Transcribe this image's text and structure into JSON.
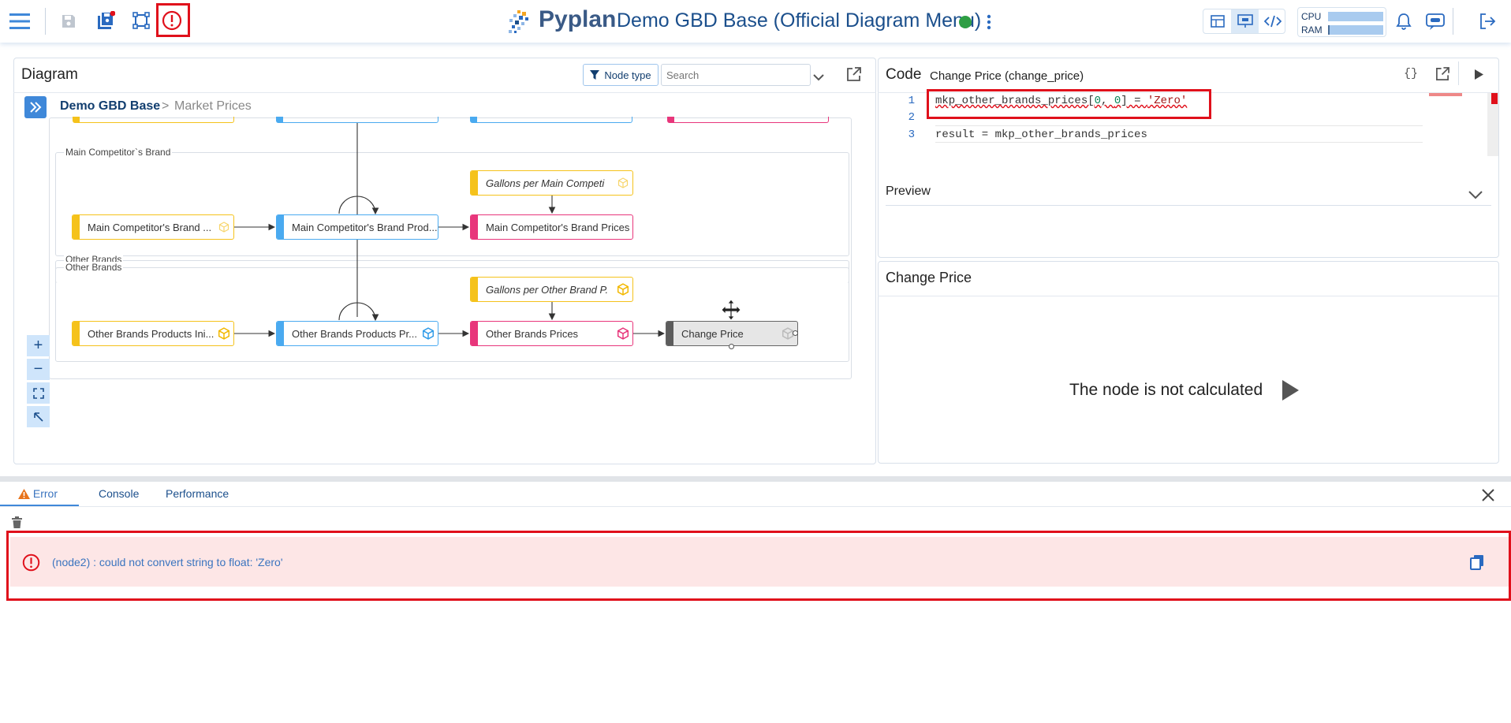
{
  "header": {
    "logo_text": "Pyplan",
    "app_title": "Demo GBD Base (Official Diagram Menu)",
    "status_color": "#2e9e44",
    "cpu_label": "CPU",
    "ram_label": "RAM",
    "cpu_usage": 0.0,
    "ram_usage": 0.03,
    "icons": [
      "menu-icon",
      "save-icon",
      "save-all-icon",
      "node-shape-icon",
      "error-alert-icon",
      "more-vert-icon",
      "table-view-icon",
      "presentation-view-icon",
      "code-view-icon",
      "notification-bell-icon",
      "assistant-icon",
      "logout-icon"
    ]
  },
  "diagram": {
    "title": "Diagram",
    "node_type_label": "Node type",
    "search_placeholder": "Search",
    "breadcrumb_root": "Demo GBD Base",
    "breadcrumb_sep": ">",
    "breadcrumb_current": "Market Prices",
    "groups": {
      "main_competitor": "Main Competitor`s Brand",
      "other_brands_outer": "Other Brands",
      "other_brands_inner": "Other Brands"
    },
    "nodes": {
      "mc_initial": "Main Competitor's Brand ...",
      "mc_products": "Main Competitor's Brand Prod...",
      "mc_gallons": "Gallons per Main Competi",
      "mc_prices": "Main Competitor's Brand Prices",
      "ob_initial": "Other Brands Products Ini...",
      "ob_products": "Other Brands Products Pr...",
      "ob_gallons": "Gallons per Other Brand P.",
      "ob_prices": "Other Brands Prices",
      "change_price": "Change Price"
    },
    "zoom_in": "+",
    "zoom_out": "−"
  },
  "code": {
    "title": "Code",
    "node_title": "Change Price (change_price)",
    "line_numbers": [
      "1",
      "2",
      "3"
    ],
    "line1_a": "mkp_other_brands_prices[",
    "line1_n1": "0",
    "line1_b": ", ",
    "line1_n2": "0",
    "line1_c": "] = ",
    "line1_str": "'Zero'",
    "line3": "result = mkp_other_brands_prices",
    "preview_label": "Preview"
  },
  "result": {
    "title": "Change Price",
    "message": "The node is not calculated"
  },
  "bottom": {
    "tabs": [
      "Error",
      "Console",
      "Performance"
    ],
    "error_message": "(node2) : could not convert string to float: 'Zero'"
  },
  "colors": {
    "accent": "#1b4f8c",
    "highlight_red": "#e0101b",
    "error_bg": "#fde6e6"
  }
}
